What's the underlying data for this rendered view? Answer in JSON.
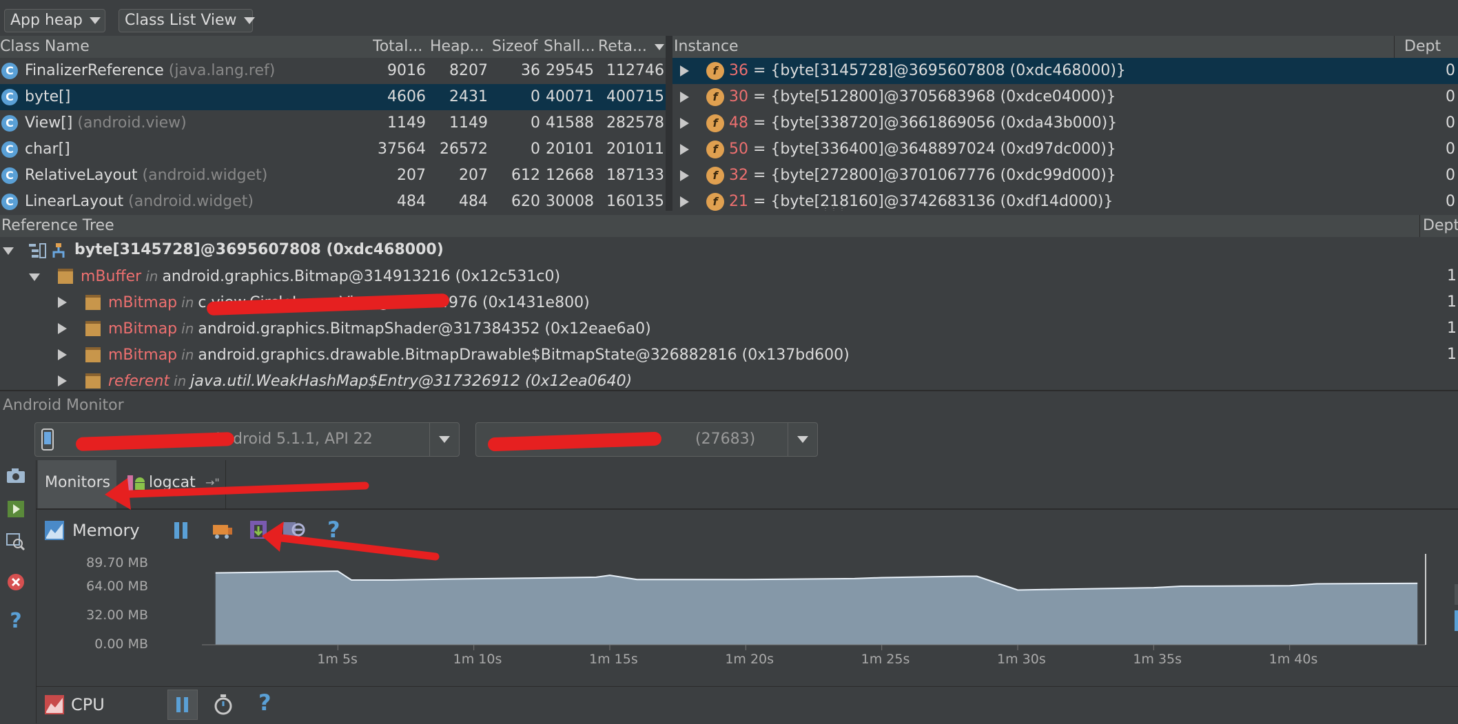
{
  "toolbar": {
    "heap_select": "App heap",
    "view_select": "Class List View"
  },
  "class_table": {
    "headers": [
      "Class Name",
      "Total...",
      "Heap...",
      "Sizeof",
      "Shall...",
      "Reta..."
    ],
    "rows": [
      {
        "name": "FinalizerReference",
        "pkg": "(java.lang.ref)",
        "total": "9016",
        "heap": "8207",
        "sizeof": "36",
        "shallow": "29545",
        "retained": "112746",
        "selected": false
      },
      {
        "name": "byte[]",
        "pkg": "",
        "total": "4606",
        "heap": "2431",
        "sizeof": "0",
        "shallow": "40071",
        "retained": "400715",
        "selected": true
      },
      {
        "name": "View[]",
        "pkg": "(android.view)",
        "total": "1149",
        "heap": "1149",
        "sizeof": "0",
        "shallow": "41588",
        "retained": "282578",
        "selected": false
      },
      {
        "name": "char[]",
        "pkg": "",
        "total": "37564",
        "heap": "26572",
        "sizeof": "0",
        "shallow": "20101",
        "retained": "201011",
        "selected": false
      },
      {
        "name": "RelativeLayout",
        "pkg": "(android.widget)",
        "total": "207",
        "heap": "207",
        "sizeof": "612",
        "shallow": "12668",
        "retained": "187133",
        "selected": false
      },
      {
        "name": "LinearLayout",
        "pkg": "(android.widget)",
        "total": "484",
        "heap": "484",
        "sizeof": "620",
        "shallow": "30008",
        "retained": "160135",
        "selected": false
      }
    ]
  },
  "instance_table": {
    "headers": [
      "Instance",
      "Dept"
    ],
    "rows": [
      {
        "id": "36",
        "text": " = {byte[3145728]@3695607808 (0xdc468000)}",
        "depth": "0",
        "selected": true
      },
      {
        "id": "30",
        "text": " = {byte[512800]@3705683968 (0xdce04000)}",
        "depth": "0",
        "selected": false
      },
      {
        "id": "48",
        "text": " = {byte[338720]@3661869056 (0xda43b000)}",
        "depth": "0",
        "selected": false
      },
      {
        "id": "50",
        "text": " = {byte[336400]@3648897024 (0xd97dc000)}",
        "depth": "0",
        "selected": false
      },
      {
        "id": "32",
        "text": " = {byte[272800]@3701067776 (0xdc99d000)}",
        "depth": "0",
        "selected": false
      },
      {
        "id": "21",
        "text": " = {byte[218160]@3742683136 (0xdf14d000)}",
        "depth": "0",
        "selected": false
      }
    ]
  },
  "reference_tree": {
    "header": "Reference Tree",
    "depth_header": "Dept",
    "root": "byte[3145728]@3695607808 (0xdc468000)",
    "rows": [
      {
        "field": "mBuffer",
        "in": "in",
        "target": "android.graphics.Bitmap@314913216 (0x12c531c0)",
        "depth": "1",
        "italic": false
      },
      {
        "field": "mBitmap",
        "in": "in",
        "target": "c                          view.CircleImageView@338814976 (0x1431e800)",
        "depth": "1",
        "italic": false
      },
      {
        "field": "mBitmap",
        "in": "in",
        "target": "android.graphics.BitmapShader@317384352 (0x12eae6a0)",
        "depth": "1",
        "italic": false
      },
      {
        "field": "mBitmap",
        "in": "in",
        "target": "android.graphics.drawable.BitmapDrawable$BitmapState@326882816 (0x137bd600)",
        "depth": "1",
        "italic": false
      },
      {
        "field": "referent",
        "in": "in",
        "target": "java.util.WeakHashMap$Entry@317326912 (0x12ea0640)",
        "depth": "",
        "italic": true
      }
    ]
  },
  "monitor": {
    "title": "Android Monitor",
    "device_suffix": "Android 5.1.1, API 22",
    "process_suffix": "(27683)",
    "tabs": [
      "Monitors",
      "logcat"
    ],
    "memory": {
      "label": "Memory",
      "y_ticks": [
        "89.70 MB",
        "64.00 MB",
        "32.00 MB",
        "0.00 MB"
      ],
      "x_ticks": [
        "1m 5s",
        "1m 10s",
        "1m 15s",
        "1m 20s",
        "1m 25s",
        "1m 30s",
        "1m 35s",
        "1m 40s"
      ]
    },
    "cpu": {
      "label": "CPU"
    }
  },
  "chart_data": {
    "type": "area",
    "title": "Memory",
    "xlabel": "",
    "ylabel": "",
    "ylim": [
      0,
      89.7
    ],
    "y_unit": "MB",
    "x": [
      "1m 0.5s",
      "1m 2s",
      "1m 4s",
      "1m 5s",
      "1m 5.5s",
      "1m 7s",
      "1m 9s",
      "1m 12s",
      "1m 14.5s",
      "1m 15s",
      "1m 16s",
      "1m 20s",
      "1m 24s",
      "1m 25s",
      "1m 28s",
      "1m 28.5s",
      "1m 30s",
      "1m 31s",
      "1m 35s",
      "1m 36s",
      "1m 40s",
      "1m 41s",
      "1m 44.7s"
    ],
    "series": [
      {
        "values": [
          75.5,
          76.0,
          77.0,
          77.3,
          68.0,
          68.0,
          69.0,
          70.0,
          71.0,
          73.0,
          68.5,
          68.6,
          69.5,
          70.5,
          72.0,
          72.0,
          57.5,
          58.0,
          60.0,
          61.5,
          62.0,
          64.0,
          64.5
        ]
      }
    ],
    "grid": false,
    "legend": "none"
  }
}
